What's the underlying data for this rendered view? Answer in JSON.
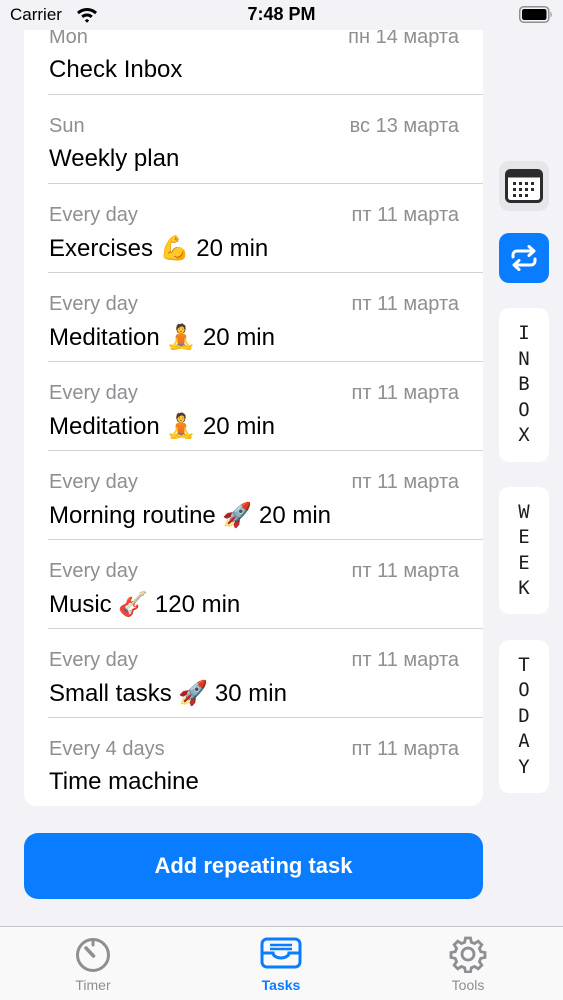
{
  "status_bar": {
    "carrier": "Carrier",
    "time": "7:48 PM"
  },
  "tasks": [
    {
      "repeat": "Mon",
      "date": "пн 14 марта",
      "title": "Check Inbox"
    },
    {
      "repeat": "Sun",
      "date": "вс 13 марта",
      "title": "Weekly plan"
    },
    {
      "repeat": "Every day",
      "date": "пт 11 марта",
      "title": "Exercises 💪 20 min"
    },
    {
      "repeat": "Every day",
      "date": "пт 11 марта",
      "title": "Meditation 🧘 20 min"
    },
    {
      "repeat": "Every day",
      "date": "пт 11 марта",
      "title": "Meditation 🧘 20 min"
    },
    {
      "repeat": "Every day",
      "date": "пт 11 марта",
      "title": "Morning routine 🚀 20 min"
    },
    {
      "repeat": "Every day",
      "date": "пт 11 марта",
      "title": "Music 🎸 120 min"
    },
    {
      "repeat": "Every day",
      "date": "пт 11 марта",
      "title": "Small tasks 🚀 30 min"
    },
    {
      "repeat": "Every 4 days",
      "date": "пт 11 марта",
      "title": "Time machine"
    }
  ],
  "side_panel": {
    "inbox_label": "INBOX",
    "week_label": "WEEK",
    "today_label": "TODAY"
  },
  "add_button": {
    "label": "Add repeating task"
  },
  "tab_bar": {
    "items": [
      {
        "label": "Timer",
        "icon": "timer-icon",
        "selected": false
      },
      {
        "label": "Tasks",
        "icon": "tray-icon",
        "selected": true
      },
      {
        "label": "Tools",
        "icon": "gear-icon",
        "selected": false
      }
    ]
  },
  "colors": {
    "accent": "#0a7cff",
    "background": "#f2f2f7",
    "secondary_text": "#8e8e93"
  }
}
